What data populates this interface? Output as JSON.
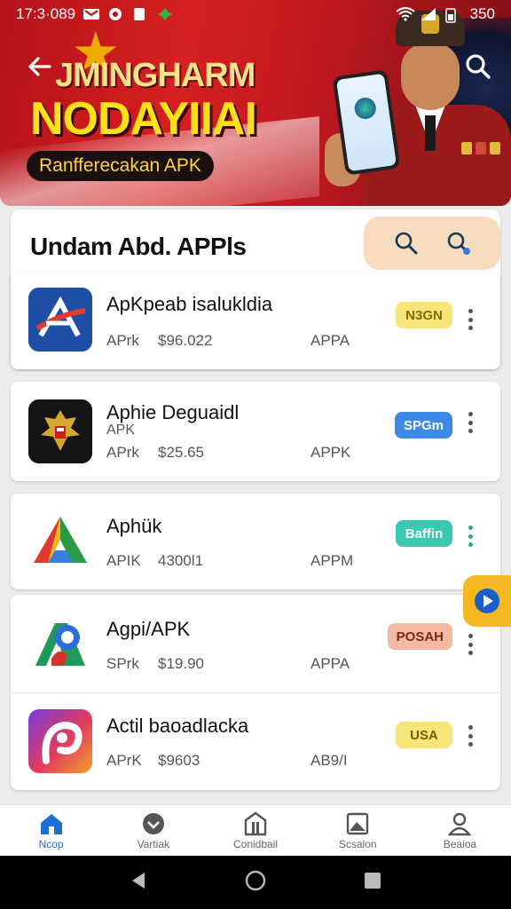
{
  "status_bar": {
    "time": "17:3·089",
    "battery": "350"
  },
  "banner": {
    "title_line1": "JMINGHARM",
    "title_line2": "NODAYIIAI",
    "pill": "Ranfferecakan APK"
  },
  "section": {
    "title": "Undam Abd. APPls"
  },
  "apps": [
    {
      "name": "ApKpeab isalukldia",
      "sub": "",
      "meta_left": "APrk",
      "price": "$96.022",
      "meta_right": "APPA",
      "badge": "N3GN",
      "badge_color": "#f8e57a",
      "badge_text_color": "#8a6a00",
      "icon": "arrow-a-app-icon"
    },
    {
      "name": "Aphie Deguaidl",
      "sub": "APK",
      "meta_left": "APrk",
      "price": "$25.65",
      "meta_right": "APPK",
      "badge": "SPGm",
      "badge_color": "#3d8ae6",
      "badge_text_color": "#ffffff",
      "icon": "garuda-app-icon"
    },
    {
      "name": "Aphük",
      "sub": "",
      "meta_left": "APIK",
      "price": "4300l1",
      "meta_right": "APPM",
      "badge": "Baffin",
      "badge_color": "#39c9b0",
      "badge_text_color": "#ffffff",
      "icon": "triangle-app-icon"
    },
    {
      "name": "Agpi/APK",
      "sub": "",
      "meta_left": "SPrk",
      "price": "$19.90",
      "meta_right": "APPA",
      "badge": "POSAH",
      "badge_color": "#f5b8a0",
      "badge_text_color": "#7a2a10",
      "icon": "map-pin-app-icon"
    },
    {
      "name": "Actil baoadlacka",
      "sub": "",
      "meta_left": "APrK",
      "price": "$9603",
      "meta_right": "AB9/I",
      "badge": "USA",
      "badge_color": "#f8e57a",
      "badge_text_color": "#7a5a00",
      "icon": "swirl-app-icon"
    }
  ],
  "bottom_nav": [
    {
      "label": "Ncop",
      "icon": "home-icon",
      "active": true
    },
    {
      "label": "Vartiak",
      "icon": "download-icon",
      "active": false
    },
    {
      "label": "Conidbail",
      "icon": "store-icon",
      "active": false
    },
    {
      "label": "Scsalon",
      "icon": "gallery-icon",
      "active": false
    },
    {
      "label": "Beaioa",
      "icon": "profile-icon",
      "active": false
    }
  ]
}
